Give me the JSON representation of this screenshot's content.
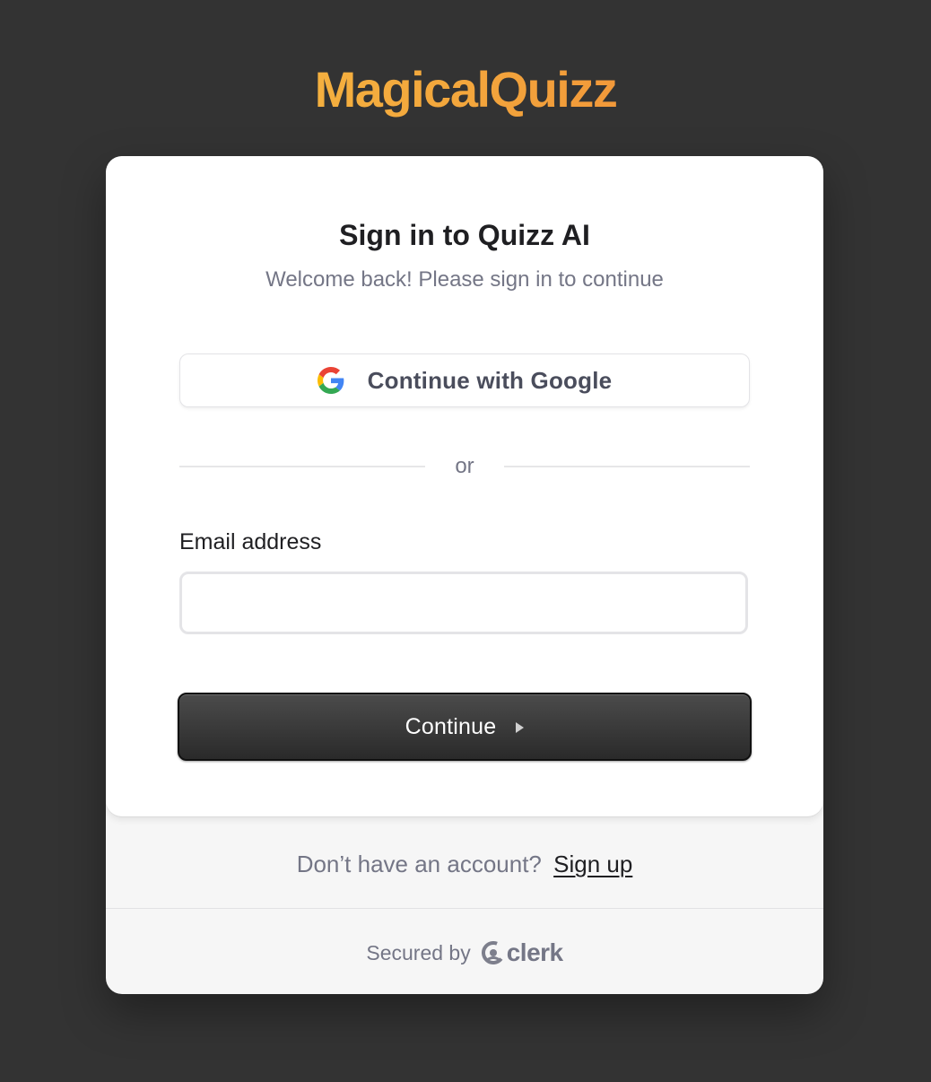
{
  "brand": {
    "name": "MagicalQuizz"
  },
  "signin": {
    "title": "Sign in to Quizz AI",
    "subtitle": "Welcome back! Please sign in to continue",
    "google_button": "Continue with Google",
    "divider_text": "or",
    "email_label": "Email address",
    "email_value": "",
    "email_placeholder": "",
    "continue_button": "Continue"
  },
  "footer": {
    "signup_prompt": "Don’t have an account?",
    "signup_link": "Sign up",
    "secured_by": "Secured by",
    "provider": "clerk"
  },
  "colors": {
    "background": "#333333",
    "brand_gradient_start": "#f6c445",
    "brand_gradient_end": "#ee7d35",
    "primary_button": "#333333",
    "muted_text": "#747686"
  },
  "icons": {
    "google": "google-g-icon",
    "continue_arrow": "play-triangle-icon",
    "provider_logo": "clerk-logo-icon"
  }
}
